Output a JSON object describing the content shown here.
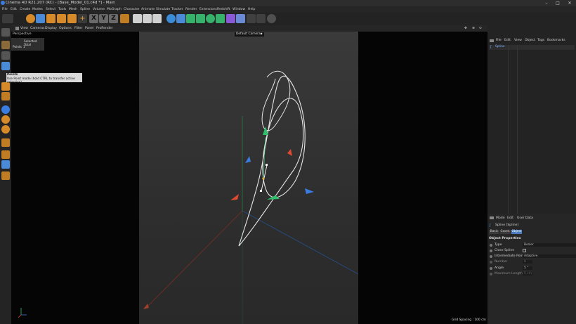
{
  "window": {
    "title": "Cinema 4D R21.207 (RC) - [Base_Model_01.c4d *] - Main",
    "minimize": "–",
    "maximize": "□",
    "close": "✕"
  },
  "menu": [
    "File",
    "Edit",
    "Create",
    "Modes",
    "Select",
    "Tools",
    "Mesh",
    "Spline",
    "Volume",
    "MoGraph",
    "Character",
    "Animate",
    "Simulate",
    "Tracker",
    "Render",
    "Extensions",
    "Redshift",
    "Window",
    "Help"
  ],
  "toolbar": {
    "axis_labels": [
      "X",
      "Y",
      "Z"
    ]
  },
  "viewport": {
    "menu": [
      "View",
      "Cameras",
      "Display",
      "Options",
      "Filter",
      "Panel",
      "ProRender"
    ],
    "name": "Perspective",
    "camera": "Default Camera",
    "camera_icon": "camera-icon",
    "hud": {
      "selected_label": "Selected Total",
      "points_label": "Points",
      "points_value": "1"
    },
    "grid_spacing": "Grid Spacing : 100 cm"
  },
  "tooltip": {
    "title": "Points",
    "text": "Use Point mode (hold CTRL to transfer active selection)"
  },
  "object_manager": {
    "menu": [
      "File",
      "Edit",
      "View",
      "Object",
      "Tags",
      "Bookmarks"
    ],
    "objects": [
      {
        "name": "Spline",
        "icon": "spline-icon"
      }
    ]
  },
  "attribute_manager": {
    "menu": [
      "Mode",
      "Edit",
      "User Data"
    ],
    "object_label": "Spline [Spline]",
    "tabs": [
      "Basic",
      "Coord.",
      "Object"
    ],
    "active_tab": "Object",
    "section": "Object Properties",
    "props": {
      "type_label": "Type",
      "type_value": "Bezier",
      "close_label": "Close Spline",
      "ip_label": "Intermediate Points",
      "ip_value": "Adaptive",
      "number_label": "Number",
      "number_value": "8",
      "angle_label": "Angle",
      "angle_value": "5 °",
      "maxlen_label": "Maximum Length",
      "maxlen_value": "5 cm"
    }
  },
  "colors": {
    "accent": "#5aa0e6",
    "x_axis": "#e04a2e",
    "y_axis": "#2fc06a",
    "z_axis": "#3a7ce0"
  }
}
